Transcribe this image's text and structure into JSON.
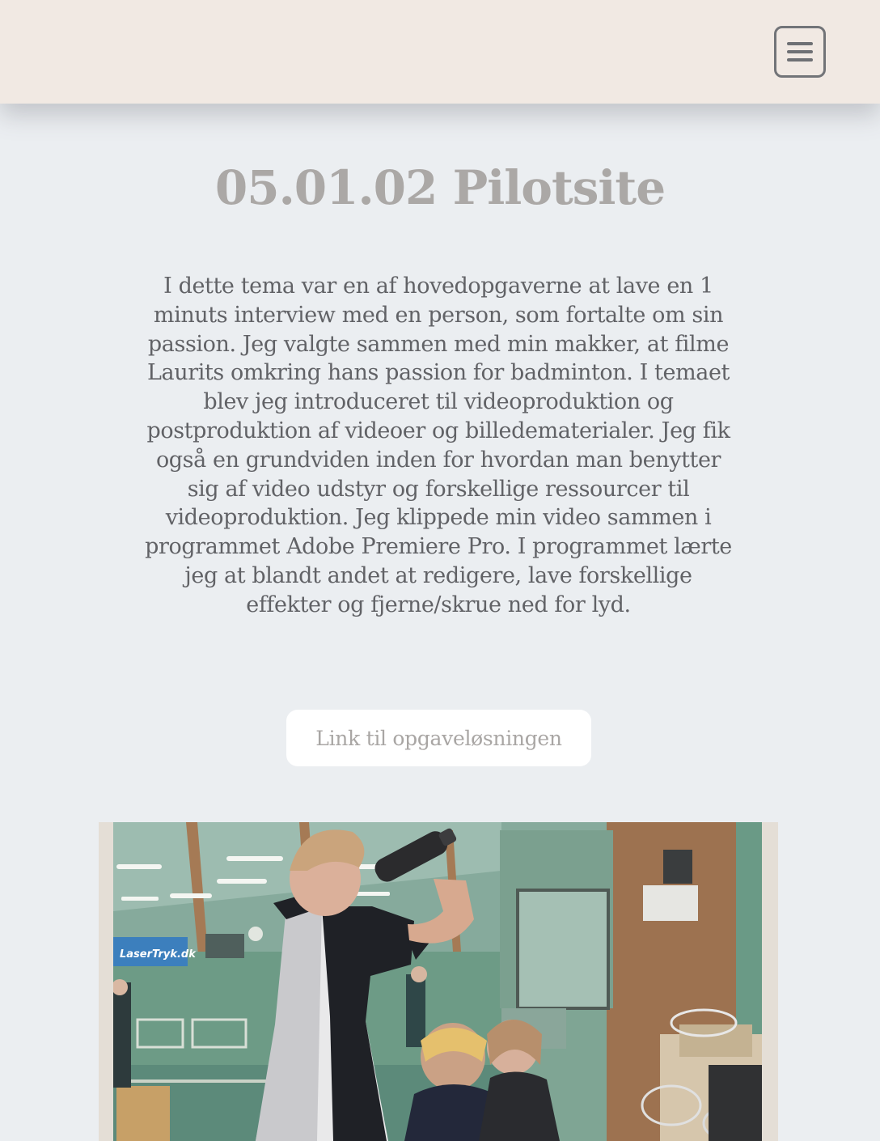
{
  "header": {
    "menu_icon": "hamburger-menu-icon"
  },
  "page": {
    "title": "05.01.02 Pilotsite",
    "description": "I dette tema var en af hovedopgaverne at lave en 1 minuts interview med en person, som fortalte om sin passion. Jeg valgte sammen med min makker, at filme Laurits omkring hans passion for badminton. I temaet blev jeg introduceret til videoproduktion og postproduktion af videoer og billedematerialer. Jeg fik også en grundviden inden for hvordan man benytter sig af video udstyr og forskellige ressourcer til videoproduktion. Jeg klippede min video sammen i programmet Adobe Premiere Pro. I programmet lærte jeg at blandt andet at redigere, lave forskellige effekter og fjerne/skrue ned for lyd.",
    "link_label": "Link til opgaveløsningen"
  },
  "video": {
    "banner_text": "LaserTryk.dk"
  },
  "colors": {
    "header_bg": "#f1e9e3",
    "page_bg": "#ebeef1",
    "title": "#aba8a6",
    "body_text": "#616266",
    "link_text": "#a9a6a4"
  }
}
